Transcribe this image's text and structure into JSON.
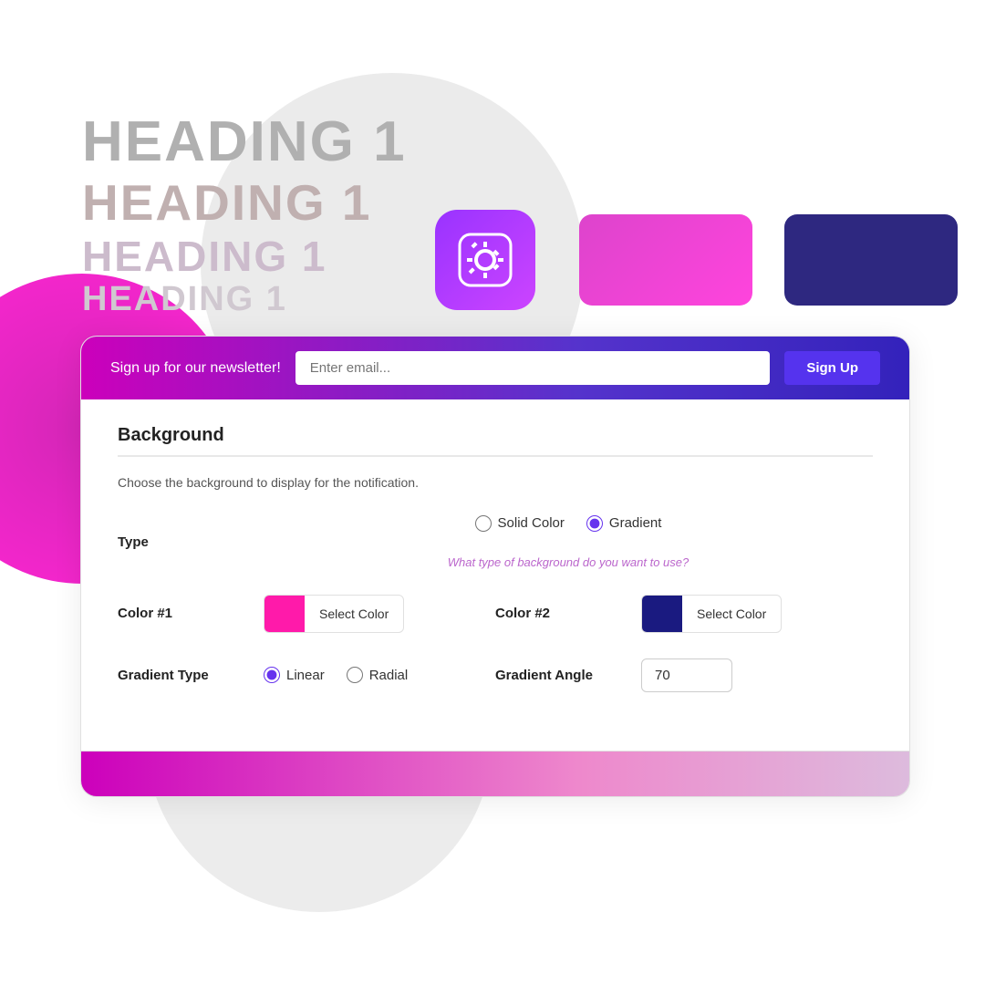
{
  "background": {
    "circles": {}
  },
  "headings": {
    "h1": "HEADING 1",
    "h2": "HEADING 1",
    "h3": "HEADING 1",
    "h4": "HEADING 1"
  },
  "gear": {
    "icon_label": "gear-icon"
  },
  "newsletter": {
    "text": "Sign up for our newsletter!",
    "placeholder": "Enter email...",
    "button_label": "Sign Up"
  },
  "card": {
    "section_title": "Background",
    "section_desc": "Choose the background to display for the notification.",
    "type_label": "Type",
    "solid_color_option": "Solid Color",
    "gradient_option": "Gradient",
    "hint": "What type of background do you want to use?",
    "color1_label": "Color #1",
    "color1_select": "Select Color",
    "color1_hex": "#ff1aaa",
    "color2_label": "Color #2",
    "color2_select": "Select Color",
    "color2_hex": "#1a1a80",
    "gradient_type_label": "Gradient Type",
    "linear_option": "Linear",
    "radial_option": "Radial",
    "gradient_angle_label": "Gradient Angle",
    "gradient_angle_value": "70"
  }
}
